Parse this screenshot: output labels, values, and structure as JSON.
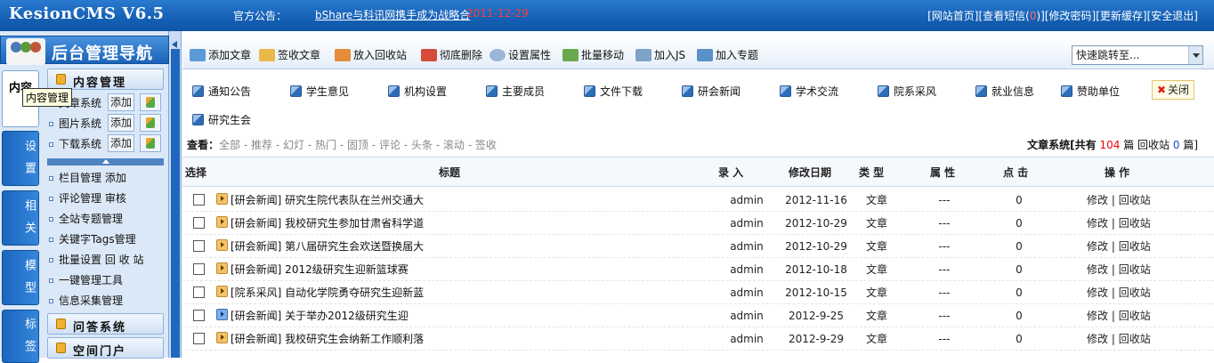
{
  "header": {
    "logo": "KesionCMS V6.5",
    "notice_label": "官方公告：",
    "notice_text": "bShare与科讯网携手成为战略合",
    "notice_date": "2011-12-29",
    "links": {
      "home": "[网站首页]",
      "sms_prefix": "[查看短信(",
      "sms_count": "0",
      "sms_suffix": ")]",
      "password": "[修改密码]",
      "cache": "[更新缓存]",
      "logout": "[安全退出]"
    }
  },
  "nav": {
    "title": "后台管理导航",
    "vtabs": [
      "内容",
      "设置",
      "相关",
      "模型",
      "标签"
    ],
    "tooltip": "内容管理",
    "content_group": "内容管理",
    "systems": [
      {
        "label": "文章系统",
        "add": "添加"
      },
      {
        "label": "图片系统",
        "add": "添加"
      },
      {
        "label": "下载系统",
        "add": "添加"
      }
    ],
    "items": [
      "栏目管理 添加",
      "评论管理 审核",
      "全站专题管理",
      "关键字Tags管理",
      "批量设置 回 收 站",
      "一键管理工具",
      "信息采集管理"
    ],
    "qa_group": "问答系统",
    "space_group": "空间门户"
  },
  "toolbar": {
    "buttons": [
      "添加文章",
      "签收文章",
      "放入回收站",
      "彻底删除",
      "设置属性",
      "批量移动",
      "加入JS",
      "加入专题"
    ],
    "quickjump": "快速跳转至..."
  },
  "categories": [
    "通知公告",
    "学生意见",
    "机构设置",
    "主要成员",
    "文件下载",
    "研会新闻",
    "学术交流",
    "院系采风",
    "就业信息",
    "赞助单位",
    "研究生会"
  ],
  "close_label": "关闭",
  "filter": {
    "label": "查看：",
    "options": [
      "全部",
      "推荐",
      "幻灯",
      "热门",
      "固顶",
      "评论",
      "头条",
      "滚动",
      "签收"
    ]
  },
  "sysinfo": {
    "prefix": "文章系统[共有",
    "total": "104",
    "mid": "篇 回收站",
    "recycle": "0",
    "suffix": "篇]"
  },
  "table": {
    "columns": [
      "选择",
      "标题",
      "录 入",
      "修改日期",
      "类 型",
      "属 性",
      "点 击",
      "操 作"
    ],
    "rows": [
      {
        "title": "[研会新闻] 研究生院代表队在兰州交通大",
        "author": "admin",
        "date": "2012-11-16",
        "type": "文章",
        "attr": "---",
        "hits": "0",
        "icon": "orange"
      },
      {
        "title": "[研会新闻] 我校研究生参加甘肃省科学道",
        "author": "admin",
        "date": "2012-10-29",
        "type": "文章",
        "attr": "---",
        "hits": "0",
        "icon": "orange"
      },
      {
        "title": "[研会新闻] 第八届研究生会欢送暨换届大",
        "author": "admin",
        "date": "2012-10-29",
        "type": "文章",
        "attr": "---",
        "hits": "0",
        "icon": "orange"
      },
      {
        "title": "[研会新闻] 2012级研究生迎新篮球赛",
        "author": "admin",
        "date": "2012-10-18",
        "type": "文章",
        "attr": "---",
        "hits": "0",
        "icon": "orange"
      },
      {
        "title": "[院系采风] 自动化学院勇夺研究生迎新蓝",
        "author": "admin",
        "date": "2012-10-15",
        "type": "文章",
        "attr": "---",
        "hits": "0",
        "icon": "orange"
      },
      {
        "title": "[研会新闻] 关于举办2012级研究生迎",
        "author": "admin",
        "date": "2012-9-25",
        "type": "文章",
        "attr": "---",
        "hits": "0",
        "icon": "blue"
      },
      {
        "title": "[研会新闻] 我校研究生会纳新工作顺利落",
        "author": "admin",
        "date": "2012-9-29",
        "type": "文章",
        "attr": "---",
        "hits": "0",
        "icon": "orange"
      }
    ],
    "op_edit": "修改",
    "op_sep": "|",
    "op_recycle": "回收站"
  }
}
